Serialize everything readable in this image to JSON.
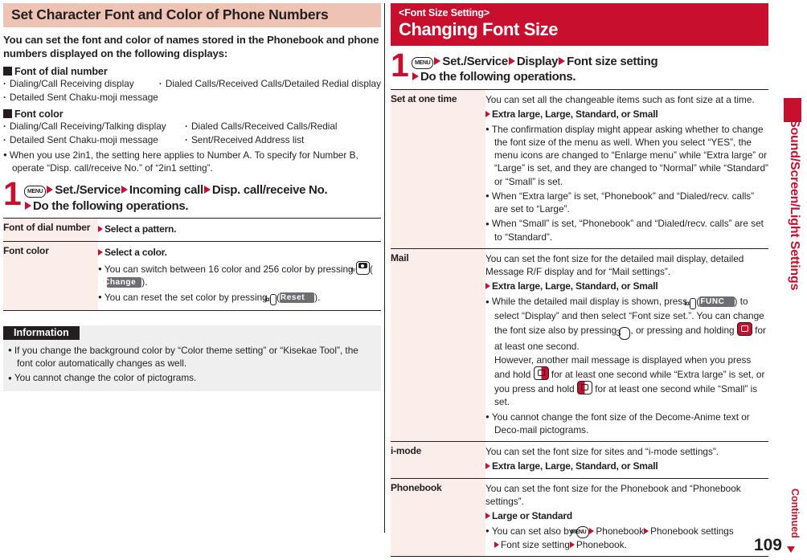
{
  "page": {
    "number": "109",
    "continued_label": "Continued",
    "side_tab_label": "Sound/Screen/Light Settings"
  },
  "colors": {
    "accent_red": "#c8102e",
    "header_pink": "#eec3b4",
    "label_cell": "#fbeeea",
    "info_bg": "#efefef",
    "ink": "#231f20",
    "softkey": "#6d6e71"
  },
  "left": {
    "header": "Set Character Font and Color of Phone Numbers",
    "lead": "You can set the font and color of names stored in the Phonebook and phone numbers displayed on the following displays:",
    "section1": {
      "title": "Font of dial number",
      "items_col1": [
        "Dialing/Call Receiving display"
      ],
      "items_col2": [
        "Dialed Calls/Received Calls/Detailed Redial display"
      ],
      "items_full": [
        "Detailed Sent Chaku-moji message"
      ]
    },
    "section2": {
      "title": "Font color",
      "items_col1": [
        "Dialing/Call Receiving/Talking display",
        "Detailed Sent Chaku-moji message"
      ],
      "items_col2": [
        "Dialed Calls/Received Calls/Redial",
        "Sent/Received Address list"
      ]
    },
    "note": "When you use 2in1, the setting here applies to Number A. To specify for Number B, operate “Disp. call/receive No.” of “2in1 setting”.",
    "step": {
      "number": "1",
      "key_menu": "MENU",
      "crumbs": [
        "Set./Service",
        "Incoming call",
        "Disp. call/receive No."
      ],
      "line2": "Do the following operations."
    },
    "table": [
      {
        "label": "Font of dial number",
        "option": "Select a pattern.",
        "bullets": []
      },
      {
        "label": "Font color",
        "option": "Select a color.",
        "bullets": [
          {
            "pre": "You can switch between 16 color and 256 color by pressing ",
            "key": "camera",
            "softkey": "Change",
            "post": "."
          },
          {
            "pre": "You can reset the set color by pressing ",
            "key": "imode",
            "softkey": "Reset",
            "post": "."
          }
        ]
      }
    ],
    "information": {
      "title": "Information",
      "items": [
        "If you change the background color by “Color theme setting” or “Kisekae Tool”, the font color automatically changes as well.",
        "You cannot change the color of pictograms."
      ]
    }
  },
  "right": {
    "header_sub": "<Font Size Setting>",
    "header_main": "Changing Font Size",
    "step": {
      "number": "1",
      "key_menu": "MENU",
      "crumbs": [
        "Set./Service",
        "Display",
        "Font size setting"
      ],
      "line2": "Do the following operations."
    },
    "table": [
      {
        "label": "Set at one time",
        "intro": "You can set all the changeable items such as font size at a time.",
        "option": "Extra large, Large, Standard, or Small",
        "bullets": [
          "The confirmation display might appear asking whether to change the font size of the menu as well. When you select “YES”, the menu icons are changed to “Enlarge menu” while “Extra large” or “Large” is set, and they are changed to “Normal” while “Standard” or “Small” is set.",
          "When “Extra large” is set, “Phonebook” and “Dialed/recv. calls” are set to “Large”.",
          "When “Small” is set, “Phonebook” and “Dialed/recv. calls” are set to “Standard”."
        ]
      },
      {
        "label": "Mail",
        "intro": "You can set the font size for the detailed mail display, detailed Message R/F display and for “Mail settings”.",
        "option": "Extra large, Large, Standard, or Small",
        "bullets_rich": [
          {
            "p1": "While the detailed mail display is shown, press ",
            "key1": "imode",
            "soft1": "FUNC",
            "p2": ") to select “Display” and then select “Font size set.”. You can change the font size also by pressing ",
            "key2": "3",
            "p3": ", or pressing and holding ",
            "key3": "nav",
            "p4": " for at least one second.",
            "p5": "However, another mail message is displayed when you press and hold ",
            "key4": "nav-left",
            "p6": " for at least one second while “Extra large” is set, or you press and hold ",
            "key5": "nav-right",
            "p7": " for at least one second while “Small” is set."
          },
          {
            "plain": "You cannot change the font size of the Decome-Anime text or Deco-mail pictograms."
          }
        ]
      },
      {
        "label": "i-mode",
        "intro": "You can set the font size for sites and “i-mode settings”.",
        "option": "Extra large, Large, Standard, or Small",
        "bullets": []
      },
      {
        "label": "Phonebook",
        "intro": "You can set the font size for the Phonebook and “Phonebook settings”.",
        "option": "Large or Standard",
        "bullet_steps": {
          "pre": "You can set also by ",
          "key": "MENU",
          "crumbs": [
            "Phonebook",
            "Phonebook settings"
          ],
          "line2_crumbs": [
            "Font size setting",
            "Phonebook."
          ]
        }
      }
    ]
  }
}
